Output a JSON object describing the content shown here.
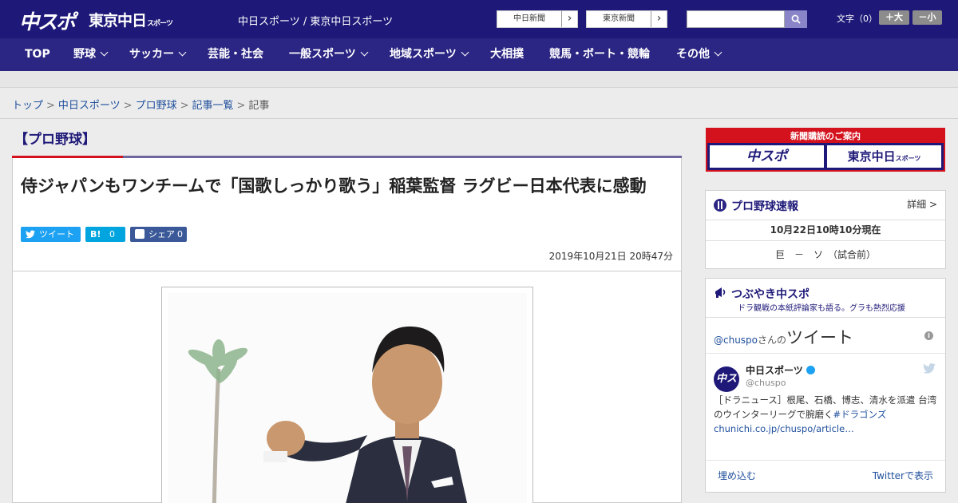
{
  "header": {
    "logo_chuspo": "中スポ",
    "logo_tokyo": "東京中日",
    "logo_tokyo_small": "スポーツ",
    "site_link_1": "中日スポーツ",
    "site_link_sep": " / ",
    "site_link_2": "東京中日スポーツ",
    "btn_chunichi": "中日新聞",
    "btn_tokyo": "東京新聞",
    "btn_arrow": "›",
    "font_label": "文字（0）",
    "font_larger": "＋大",
    "font_smaller": "－小"
  },
  "nav": {
    "top": "TOP",
    "baseball": "野球",
    "soccer": "サッカー",
    "entertainment": "芸能・社会",
    "general_sports": "一般スポーツ",
    "local_sports": "地域スポーツ",
    "sumo": "大相撲",
    "keiba": "競馬・ボート・競輪",
    "other": "その他"
  },
  "breadcrumb": {
    "top": "トップ",
    "chunichi_sports": "中日スポーツ",
    "pro_baseball": "プロ野球",
    "article_list": "記事一覧",
    "current": "記事",
    "sep": ">"
  },
  "article": {
    "category": "【プロ野球】",
    "headline": "侍ジャパンもワンチームで「国歌しっかり歌う」稲葉監督 ラグビー日本代表に感動",
    "tweet_label": "ツイート",
    "hatena_icon": "B!",
    "hatena_count": "0",
    "facebook_label": "シェア",
    "facebook_count": "0",
    "date": "2019年10月21日 20時47分"
  },
  "sidebar": {
    "subscribe_title": "新聞購読のご案内",
    "subscribe_chuspo": "中スポ",
    "subscribe_tokyo": "東京中日",
    "subscribe_tokyo_small": "スポーツ",
    "live_title": "プロ野球速報",
    "live_detail": "詳細 >",
    "live_time": "10月22日10時10分現在",
    "live_score": "巨　－　ソ　（試合前）",
    "tsubuyaki_title": "つぶやき中スポ",
    "tsubuyaki_sub": "ドラ観戦の本紙評論家も語る。グラも熱烈応援",
    "tw_handle_link": "@chuspo",
    "tw_handle_san": "さんの",
    "tw_header_big": "ツイート",
    "tw_user": "中日スポーツ",
    "tw_user_handle": "@chuspo",
    "tw_avatar_text": "中ス",
    "tw_body": "［ドラニュース］根尾、石橋、博志、清水を派遣 台湾のウインターリーグで腕磨く",
    "tw_link": "#ドラゴンズchunichi.co.jp/chuspo/article…",
    "tw_embed": "埋め込む",
    "tw_view_on": "Twitterで表示"
  },
  "colors": {
    "header_bg": "#1e1978",
    "nav_bg": "#2b2583",
    "accent_red": "#d4121d",
    "twitter_blue": "#1da1f2",
    "hatena_blue": "#00a4de",
    "facebook_blue": "#3b5998"
  }
}
